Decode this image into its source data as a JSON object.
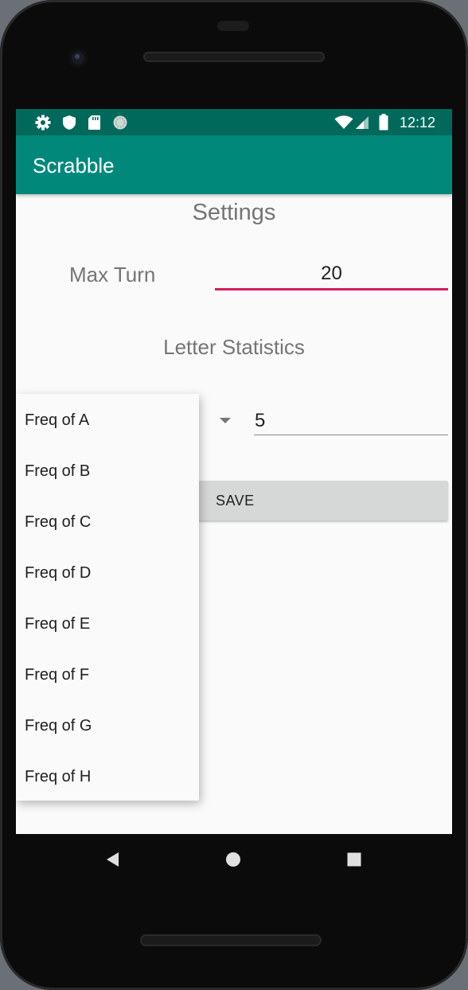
{
  "status_bar": {
    "time": "12:12",
    "left_icons": [
      "gear-icon",
      "shield-icon",
      "sdcard-icon",
      "circle-icon"
    ],
    "right_icons": [
      "wifi-icon",
      "signal-icon",
      "battery-icon"
    ]
  },
  "app_bar": {
    "title": "Scrabble",
    "color": "#00897b",
    "status_color": "#00695c"
  },
  "settings": {
    "title": "Settings",
    "max_turn_label": "Max Turn",
    "max_turn_value": "20",
    "letter_stats_title": "Letter Statistics",
    "freq_value": "5",
    "save_label": "SAVE"
  },
  "dropdown": {
    "items": [
      "Freq of A",
      "Freq of B",
      "Freq of C",
      "Freq of D",
      "Freq of E",
      "Freq of F",
      "Freq of G",
      "Freq of H"
    ]
  },
  "colors": {
    "accent": "#d81b60",
    "background": "#fafafa",
    "text_secondary": "#757575"
  },
  "nav_bar": {
    "icons": [
      "back-icon",
      "home-icon",
      "recents-icon"
    ]
  }
}
